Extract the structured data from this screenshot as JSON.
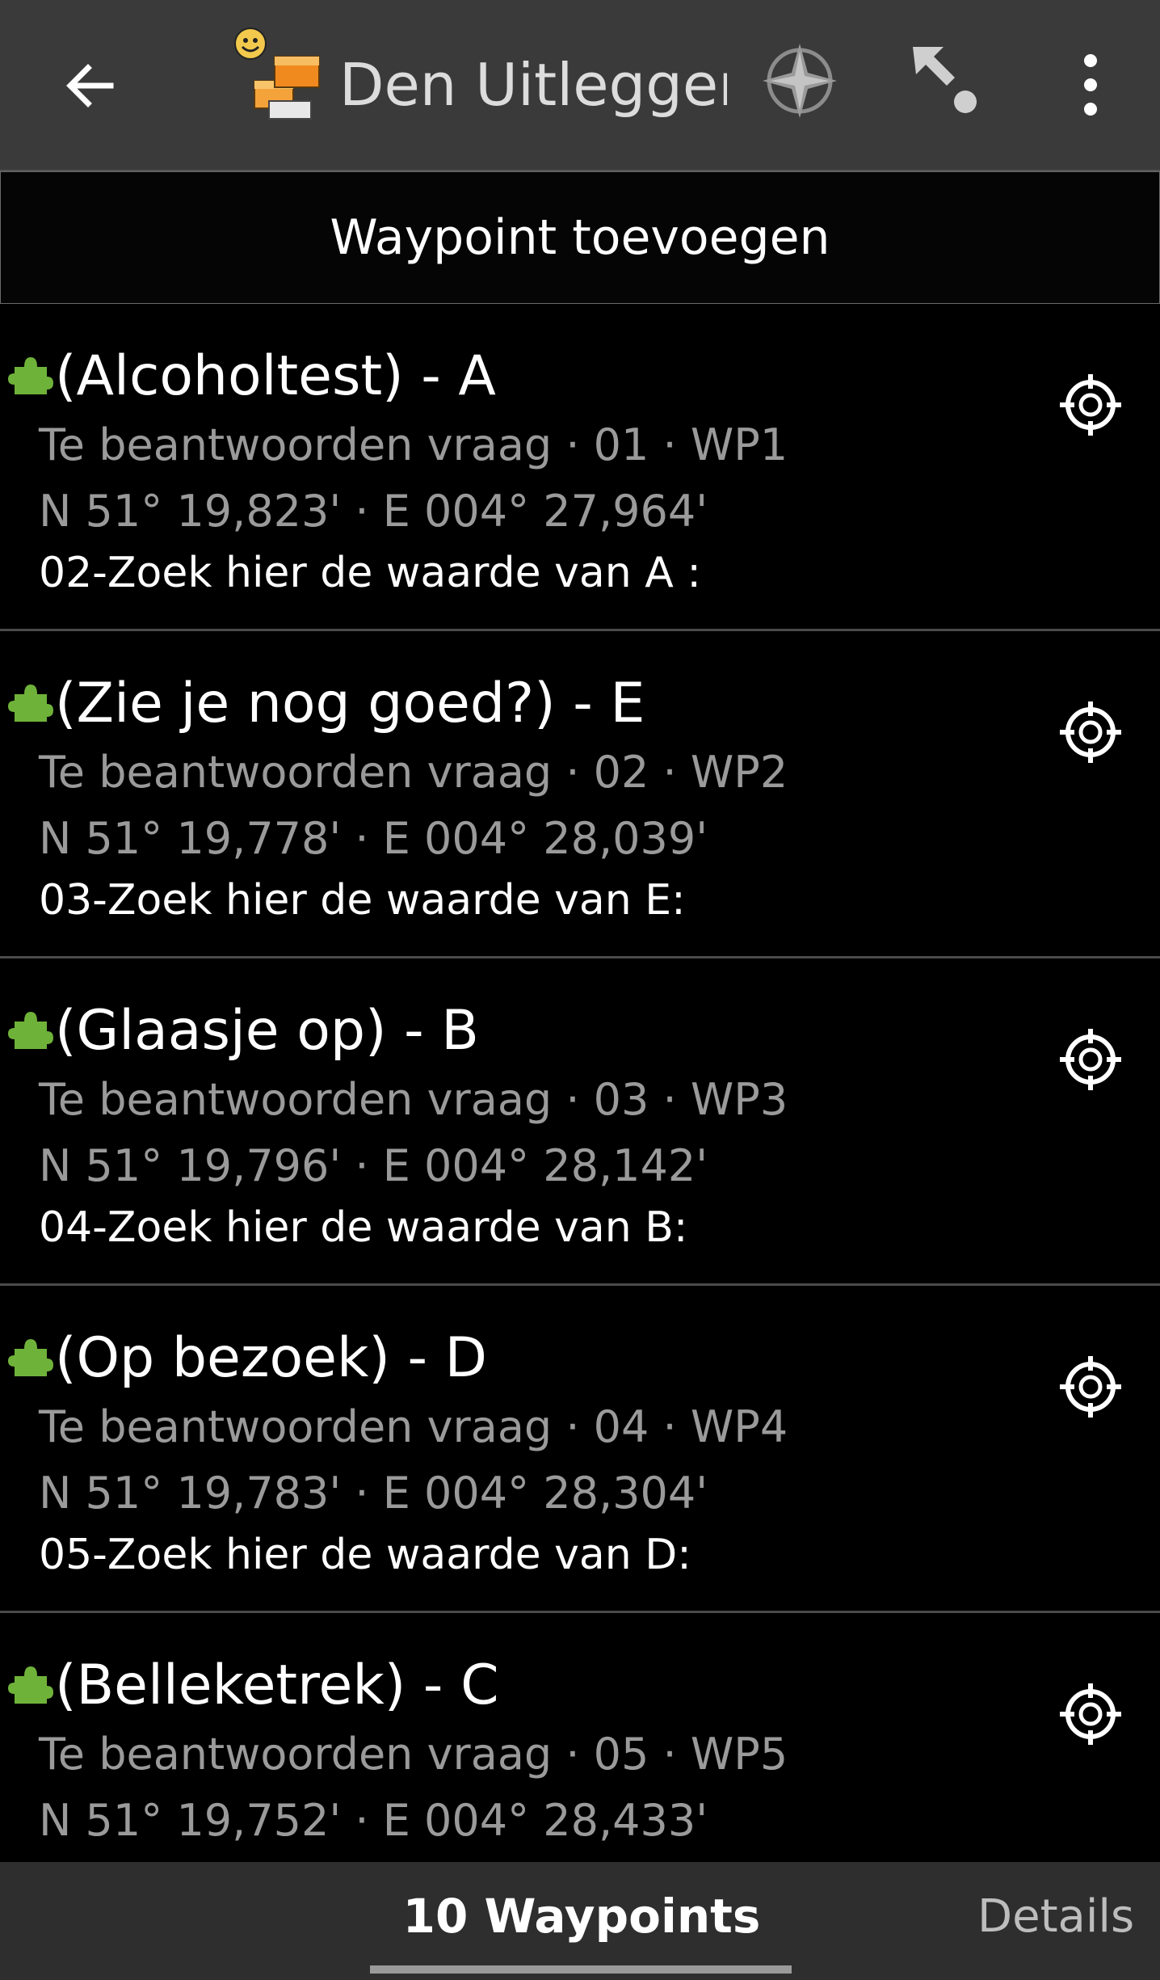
{
  "appbar": {
    "title": "Den Uitlegger...",
    "back_icon": "arrow-left-icon",
    "cache_icon": "cache-type-icon",
    "compass_icon": "compass-icon",
    "navigate_icon": "navigate-icon",
    "menu_icon": "more-vert-icon"
  },
  "add_waypoint_label": "Waypoint toevoegen",
  "waypoints": [
    {
      "name": "(Alcoholtest) - A",
      "meta": "Te beantwoorden vraag · 01 · WP1",
      "coords": "N 51° 19,823' · E 004° 27,964'",
      "note": "02-Zoek hier de waarde van A :"
    },
    {
      "name": "(Zie je nog goed?) - E",
      "meta": "Te beantwoorden vraag · 02 · WP2",
      "coords": "N 51° 19,778' · E 004° 28,039'",
      "note": "03-Zoek hier de waarde van E:"
    },
    {
      "name": "(Glaasje op) - B",
      "meta": "Te beantwoorden vraag · 03 · WP3",
      "coords": "N 51° 19,796' · E 004° 28,142'",
      "note": "04-Zoek hier de waarde van B:"
    },
    {
      "name": "(Op bezoek) - D",
      "meta": "Te beantwoorden vraag · 04 · WP4",
      "coords": "N 51° 19,783' · E 004° 28,304'",
      "note": "05-Zoek hier de waarde van D:"
    },
    {
      "name": "(Belleketrek) - C",
      "meta": "Te beantwoorden vraag · 05 · WP5",
      "coords": "N 51° 19,752' · E 004° 28,433'",
      "note": ""
    }
  ],
  "tabs": {
    "waypoints": "10 Waypoints",
    "details": "Details"
  },
  "colors": {
    "appbar_bg": "#3a3a3a",
    "list_bg": "#000000",
    "puzzle_green": "#6fb23a",
    "secondary_text": "#9a9a9a"
  }
}
